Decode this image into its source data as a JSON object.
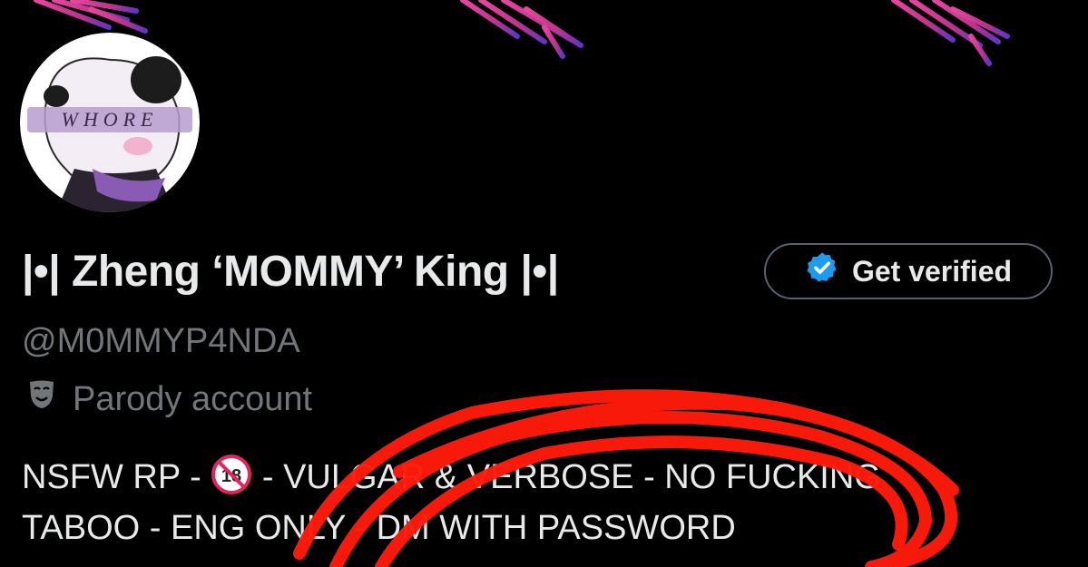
{
  "profile": {
    "display_name": "|•| Zheng ‘MOMMY’ King |•|",
    "handle": "@M0MMYP4NDA",
    "label": "Parody account",
    "label_icon": "theater-masks-icon",
    "get_verified_label": "Get verified",
    "avatar_text": "WHORE",
    "bio_line1_before": "NSFW RP - ",
    "bio_line1_badge": "18",
    "bio_line1_after": " - VULGAR & VERBOSE - NO FUCKING",
    "bio_line2": "TABOO - ENG ONLY - DM WITH PASSWORD"
  },
  "colors": {
    "background": "#000000",
    "primary_text": "#e7e9ea",
    "secondary_text": "#71767b",
    "verified_blue": "#1d9bf0",
    "scribble_red": "#ff1a0a",
    "banner_pink": "#e0409a"
  }
}
